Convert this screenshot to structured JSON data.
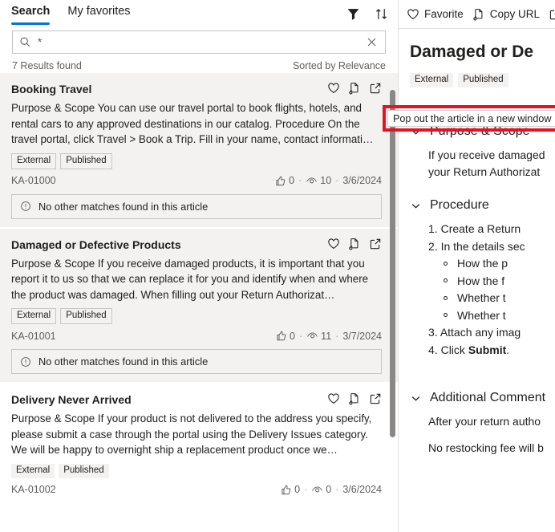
{
  "left_panel": {
    "tabs": [
      {
        "label": "Search",
        "active": true
      },
      {
        "label": "My favorites",
        "active": false
      }
    ],
    "toolbar_icons": [
      {
        "name": "filter-icon",
        "label": "Filter"
      },
      {
        "name": "sort-icon",
        "label": "Sort"
      }
    ],
    "search": {
      "value": "*",
      "placeholder": "Search",
      "search_icon": "search-icon",
      "clear_icon": "clear-icon"
    },
    "results_count_label": "7 Results found",
    "sort_label": "Sorted by Relevance",
    "card_action_icons": [
      {
        "name": "favorite-heart-icon",
        "title": "Favorite"
      },
      {
        "name": "copy-url-icon",
        "title": "Copy URL"
      },
      {
        "name": "pop-out-icon",
        "title": "Pop out the article in a new window"
      }
    ],
    "no_match_label": "No other matches found in this article",
    "results": [
      {
        "title": "Booking Travel",
        "snippet": "Purpose & Scope You can use our travel portal to book flights, hotels, and rental cars to any approved destinations in our catalog. Procedure On the travel portal, click Travel > Book a Trip. Fill in your name, contact informati…",
        "badges": [
          "External",
          "Published"
        ],
        "badges_bordered": true,
        "article_number": "KA-01000",
        "likes": "0",
        "views": "10",
        "date": "3/6/2024",
        "highlighted": true,
        "show_no_match": true
      },
      {
        "title": "Damaged or Defective Products",
        "snippet": "  Purpose & Scope If you receive damaged products, it is important that you report it to us so that we can replace it for you and identify when and where the product was damaged. When filling out your Return Authorizat…",
        "badges": [
          "External",
          "Published"
        ],
        "badges_bordered": true,
        "article_number": "KA-01001",
        "likes": "0",
        "views": "11",
        "date": "3/7/2024",
        "highlighted": true,
        "show_no_match": true
      },
      {
        "title": "Delivery Never Arrived",
        "snippet": "Purpose & Scope If your product is not delivered to the address you specify, please submit a case through the portal using the Delivery Issues category. We will be happy to overnight ship a replacement product once we…",
        "badges": [
          "External",
          "Published"
        ],
        "badges_bordered": false,
        "article_number": "KA-01002",
        "likes": "0",
        "views": "0",
        "date": "3/6/2024",
        "highlighted": false,
        "show_no_match": false
      }
    ]
  },
  "right_panel": {
    "toolbar": [
      {
        "icon": "favorite-heart-icon",
        "label": "Favorite"
      },
      {
        "icon": "copy-url-icon",
        "label": "Copy URL"
      },
      {
        "icon": "pop-out-icon",
        "label": ""
      }
    ],
    "article_title": "Damaged or De",
    "badges": [
      "External",
      "Published"
    ],
    "sections": [
      {
        "heading": "Purpose & Scope",
        "chevron": "chevron-down-icon",
        "paragraphs": [
          "If you receive damaged",
          "your Return Authorizat"
        ]
      },
      {
        "heading": "Procedure",
        "chevron": "chevron-down-icon",
        "ordered": [
          {
            "num": "1.",
            "text": "Create a Return "
          },
          {
            "num": "2.",
            "text": "In the details sec"
          }
        ],
        "sub_bullets": [
          "How the p",
          "How the f",
          "Whether t",
          "Whether t"
        ],
        "ordered_after": [
          {
            "num": "3.",
            "text": "Attach any imag"
          },
          {
            "num": "4.",
            "text": "Click ",
            "bold": "Submit",
            "tail": "."
          }
        ]
      },
      {
        "heading": "Additional Comment",
        "chevron": "chevron-down-icon",
        "paragraphs": [
          "After your return autho",
          "No restocking fee will b"
        ]
      }
    ]
  },
  "tooltip": {
    "text": "Pop out the article in a new window",
    "highlight_color": "#e81123"
  }
}
